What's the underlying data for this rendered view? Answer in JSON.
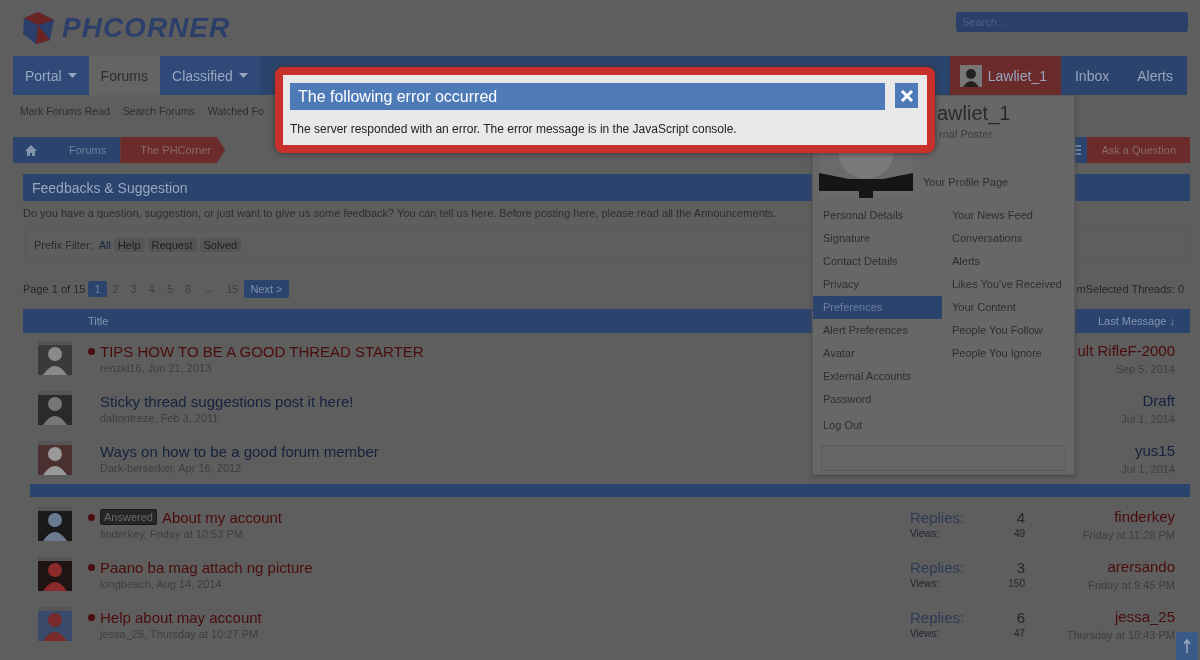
{
  "header": {
    "logo": "PHCORNER",
    "search": {
      "placeholder": "Search..."
    }
  },
  "nav": {
    "tabs": [
      {
        "label": "Portal",
        "dropdown": true,
        "selected": false
      },
      {
        "label": "Forums",
        "dropdown": false,
        "selected": true
      },
      {
        "label": "Classified",
        "dropdown": true,
        "selected": false
      }
    ],
    "user": "Lawliet_1",
    "links": [
      "Inbox",
      "Alerts"
    ]
  },
  "subnav": [
    "Mark Forums Read",
    "Search Forums",
    "Watched Fo"
  ],
  "breadcrumb": [
    {
      "label": "Forums",
      "kind": "link"
    },
    {
      "label": "The PHCorner",
      "kind": "current"
    }
  ],
  "ask_button": "Ask a Question",
  "forum": {
    "title": "Feedbacks & Suggestion",
    "description": "Do you have a question, suggestion, or just want to give us some feedback? You can tell us here. Before posting here, please read all the Announcements.",
    "prefix_filter": {
      "label": "Prefix Filter:",
      "options": [
        {
          "label": "All",
          "kind": "link"
        },
        {
          "label": "Help",
          "kind": "chip"
        },
        {
          "label": "Request",
          "kind": "chip"
        },
        {
          "label": "Solved",
          "kind": "chip"
        }
      ]
    }
  },
  "pagination": {
    "label": "Page 1 of 15",
    "pages": [
      {
        "label": "1",
        "selected": true
      },
      {
        "label": "2",
        "selected": false
      },
      {
        "label": "3",
        "selected": false
      },
      {
        "label": "4",
        "selected": false
      },
      {
        "label": "5",
        "selected": false
      },
      {
        "label": "6",
        "selected": false
      },
      {
        "label": "→",
        "selected": false
      },
      {
        "label": "15",
        "selected": false
      }
    ],
    "next": "Next >"
  },
  "thread_tools": {
    "cut_text": "m",
    "selected_threads": "Selected Threads: 0"
  },
  "table": {
    "columns": [
      "Title",
      "Last Message ↓"
    ]
  },
  "sticky_threads": [
    {
      "title": "TIPS HOW TO BE A GOOD THREAD STARTER",
      "unread": true,
      "starter": "renzki16, Jun 21, 2013",
      "last_message": {
        "user": "ult RifleF-2000",
        "color": "#4a0c0c",
        "time": "Sep 5, 2014"
      }
    },
    {
      "title": "Sticky thread suggestions post it here!",
      "unread": false,
      "starter": "daltontreze, Feb 3, 2011",
      "last_message": {
        "user": "Draft",
        "color": "#14223f",
        "time": "Jul 1, 2014"
      }
    },
    {
      "title": "Ways on how to be a good forum member",
      "unread": false,
      "starter": "Dark-berserker, Apr 16, 2012",
      "last_message": {
        "user": "yus15",
        "color": "#14223f",
        "time": "Jul 1, 2014"
      }
    }
  ],
  "threads": [
    {
      "title": "About my account",
      "prefix": "Answered",
      "unread": true,
      "starter": "finderkey, Friday at 10:53 PM",
      "stats": {
        "replies_label": "Replies:",
        "replies": "4",
        "views_label": "Views:",
        "views": "49"
      },
      "last_message": {
        "user": "finderkey",
        "color": "#4a0c0c",
        "time": "Friday at 11:28 PM"
      }
    },
    {
      "title": "Paano ba mag attach ng picture",
      "unread": true,
      "starter": "longbeach, Aug 14, 2014",
      "stats": {
        "replies_label": "Replies:",
        "replies": "3",
        "views_label": "Views:",
        "views": "150"
      },
      "last_message": {
        "user": "arersando",
        "color": "#4a0c0c",
        "time": "Friday at 9:45 PM"
      }
    },
    {
      "title": "Help about may account",
      "unread": true,
      "starter": "jessa_25, Thursday at 10:27 PM",
      "stats": {
        "replies_label": "Replies:",
        "replies": "6",
        "views_label": "Views:",
        "views": "47"
      },
      "last_message": {
        "user": "jessa_25",
        "color": "#4a0c0c",
        "time": "Thursday at 10:43 PM"
      }
    }
  ],
  "user_menu": {
    "name": "awliet_1",
    "user_title": "rnal Poster",
    "profile_link": "Your Profile Page",
    "left": [
      {
        "label": "Personal Details",
        "selected": false
      },
      {
        "label": "Signature",
        "selected": false
      },
      {
        "label": "Contact Details",
        "selected": false
      },
      {
        "label": "Privacy",
        "selected": false
      },
      {
        "label": "Preferences",
        "selected": true
      },
      {
        "label": "Alert Preferences",
        "selected": false
      },
      {
        "label": "Avatar",
        "selected": false
      },
      {
        "label": "External Accounts",
        "selected": false
      },
      {
        "label": "Password",
        "selected": false
      }
    ],
    "right": [
      {
        "label": "Your News Feed",
        "selected": false
      },
      {
        "label": "Conversations",
        "selected": false
      },
      {
        "label": "Alerts",
        "selected": false
      },
      {
        "label": "Likes You've Received",
        "selected": false
      },
      {
        "label": "Your Content",
        "selected": false
      },
      {
        "label": "People You Follow",
        "selected": false
      },
      {
        "label": "People You Ignore",
        "selected": false
      }
    ],
    "logout": "Log Out"
  },
  "dialog": {
    "title": "The following error occurred",
    "message": "The server responded with an error. The error message is in the JavaScript console."
  }
}
